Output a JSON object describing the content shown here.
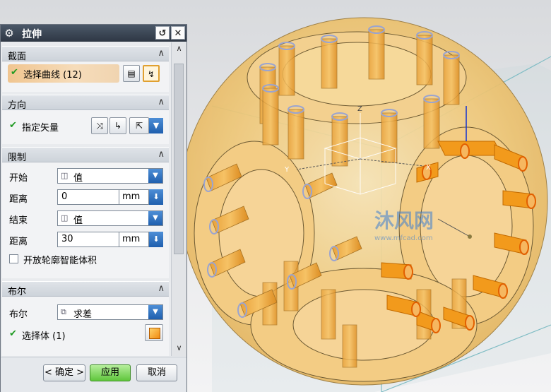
{
  "dialog": {
    "title": "拉伸",
    "gear_icon": "gear-icon",
    "reset_glyph": "↺",
    "close_glyph": "✕"
  },
  "sections": {
    "section": {
      "title": "截面",
      "select_curve_label": "选择曲线 (12)"
    },
    "direction": {
      "title": "方向",
      "vector_label": "指定矢量"
    },
    "limits": {
      "title": "限制",
      "start_label": "开始",
      "start_value": "值",
      "start_distance_label": "距离",
      "start_distance_value": "0",
      "start_unit": "mm",
      "end_label": "结束",
      "end_value": "值",
      "end_distance_label": "距离",
      "end_distance_value": "30",
      "end_unit": "mm",
      "open_profile_label": "开放轮廓智能体积"
    },
    "boolean": {
      "title": "布尔",
      "boolean_label": "布尔",
      "boolean_value": "求差",
      "select_body_label": "选择体 (1)"
    }
  },
  "buttons": {
    "ok": "< 确定 >",
    "apply": "应用",
    "cancel": "取消"
  },
  "colors": {
    "accent_orange": "#f29a1c",
    "title_bar": "#3a4554",
    "check_green": "#1f9a22",
    "apply_green": "#5fc63c"
  },
  "viewport": {
    "axis_x": "X",
    "axis_y": "Y",
    "axis_z": "Z",
    "watermark": "沐风网",
    "watermark_url": "www.mfcad.com"
  }
}
